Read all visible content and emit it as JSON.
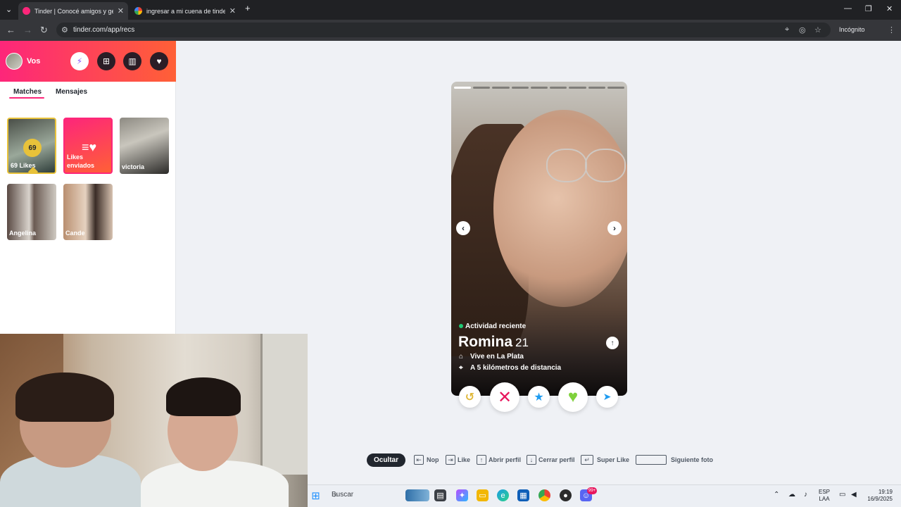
{
  "browser": {
    "tabs": [
      {
        "title": "Tinder | Conocé amigos y gente",
        "close": "✕"
      },
      {
        "title": "ingresar a mi cuena de tinder p",
        "close": "✕"
      }
    ],
    "new_tab": "+",
    "url": "tinder.com/app/recs",
    "incognito_label": "Incógnito",
    "window_controls": {
      "minimize": "—",
      "restore": "❐",
      "close": "✕"
    }
  },
  "sidebar": {
    "user_name": "Vos",
    "tabs": {
      "matches": "Matches",
      "messages": "Mensajes"
    },
    "cards": {
      "likes_count": "69",
      "likes_label": "69 Likes",
      "sent_label": "Likes enviados",
      "matches": [
        "victoria",
        "Angelina",
        "Cande"
      ]
    }
  },
  "profile": {
    "activity": "Actividad reciente",
    "name": "Romina",
    "age": "21",
    "lives_in": "Vive en La Plata",
    "distance": "A 5 kilómetros de distancia",
    "photo_count": 9,
    "current_photo": 1
  },
  "shortcuts": {
    "hide": "Ocultar",
    "items": [
      "Nop",
      "Like",
      "Abrir perfil",
      "Cerrar perfil",
      "Super Like",
      "Siguiente foto"
    ]
  },
  "taskbar": {
    "search": "Buscar",
    "lang_top": "ESP",
    "lang_bottom": "LAA",
    "time": "19:19",
    "date": "16/9/2025",
    "badge": "99+"
  },
  "colors": {
    "brand_start": "#fd267a",
    "brand_end": "#ff6036",
    "gold": "#e8c23a",
    "like_green": "#7fd13b",
    "nope_pink": "#e8175d",
    "superlike_blue": "#1e9bf0"
  }
}
